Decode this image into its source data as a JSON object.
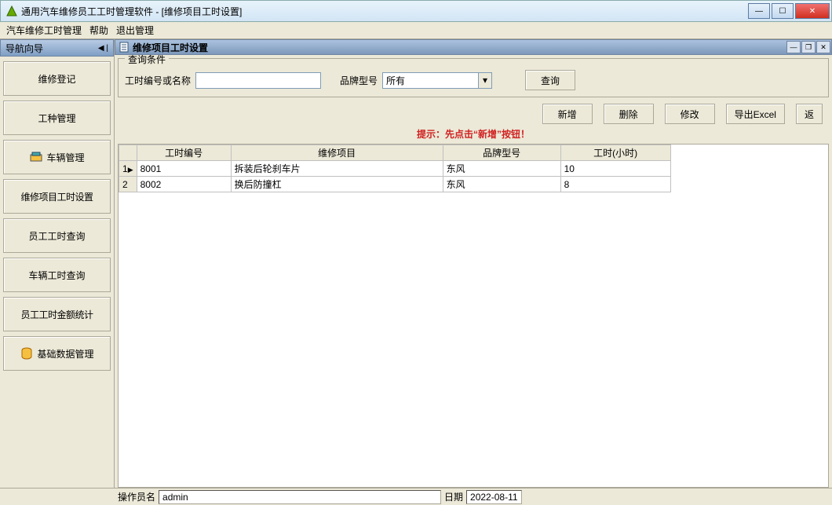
{
  "window": {
    "title": "通用汽车维修员工工时管理软件    - [维修项目工时设置]"
  },
  "menu": {
    "m1": "汽车维修工时管理",
    "m2": "帮助",
    "m3": "退出管理"
  },
  "nav": {
    "header": "导航向导",
    "items": {
      "i0": "维修登记",
      "i1": "工种管理",
      "i2": "车辆管理",
      "i3": "维修项目工时设置",
      "i4": "员工工时查询",
      "i5": "车辆工时查询",
      "i6": "员工工时金额统计",
      "i7": "基础数据管理"
    }
  },
  "child": {
    "title": "维修项目工时设置"
  },
  "query": {
    "legend": "查询条件",
    "field1_label": "工时编号或名称",
    "field1_value": "",
    "brand_label": "品牌型号",
    "brand_value": "所有",
    "search_btn": "查询"
  },
  "actions": {
    "add": "新增",
    "del": "删除",
    "edit": "修改",
    "export": "导出Excel",
    "ret": "返"
  },
  "hint": "提示：先点击“新增”按钮！",
  "grid": {
    "cols": {
      "c0": "工时编号",
      "c1": "维修项目",
      "c2": "品牌型号",
      "c3": "工时(小时)"
    },
    "rows": [
      {
        "n": "1",
        "ptr": "▶",
        "code": "8001",
        "proj": "拆装后轮刹车片",
        "brand": "东风",
        "hours": "10"
      },
      {
        "n": "2",
        "ptr": "",
        "code": "8002",
        "proj": "换后防撞杠",
        "brand": "东风",
        "hours": "8"
      }
    ]
  },
  "status": {
    "op_label": "操作员名",
    "op_value": "admin",
    "date_label": "日期",
    "date_value": "2022-08-11"
  }
}
